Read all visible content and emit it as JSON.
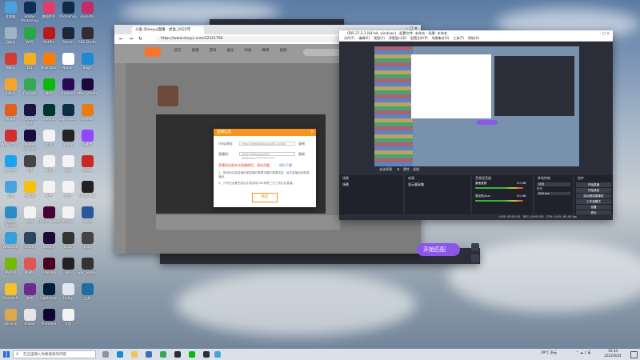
{
  "desktop": {
    "icons": [
      {
        "label": "此电脑",
        "color": "#4aa3df",
        "col": 0,
        "row": 0
      },
      {
        "label": "Adobe Photoshop",
        "color": "#0c2d56",
        "col": 1,
        "row": 0
      },
      {
        "label": "美图秀秀",
        "color": "#e23c6b",
        "col": 2,
        "row": 0
      },
      {
        "label": "Photoshop",
        "color": "#0e2a47",
        "col": 3,
        "row": 0
      },
      {
        "label": "Aseprite",
        "color": "#c42b6b",
        "col": 4,
        "row": 0
      },
      {
        "label": "回收站",
        "color": "#9fb4c7",
        "col": 0,
        "row": 1
      },
      {
        "label": "WPS",
        "color": "#27a844",
        "col": 1,
        "row": 1
      },
      {
        "label": "Netflix",
        "color": "#b71c1c",
        "col": 2,
        "row": 1
      },
      {
        "label": "Steam",
        "color": "#1b2838",
        "col": 3,
        "row": 1
      },
      {
        "label": "OBS Studio",
        "color": "#302e31",
        "col": 4,
        "row": 1
      },
      {
        "label": "网易云",
        "color": "#d33a31",
        "col": 0,
        "row": 2
      },
      {
        "label": "QQ",
        "color": "#f2b01e",
        "col": 1,
        "row": 2
      },
      {
        "label": "Illustrator",
        "color": "#ff7c00",
        "col": 2,
        "row": 2
      },
      {
        "label": "Notion",
        "color": "#ffffff",
        "col": 3,
        "row": 2
      },
      {
        "label": "Edge",
        "color": "#1e8ad2",
        "col": 4,
        "row": 2
      },
      {
        "label": "Bilibili",
        "color": "#f2a72a",
        "col": 0,
        "row": 3
      },
      {
        "label": "Chrome",
        "color": "#35a853",
        "col": 1,
        "row": 3
      },
      {
        "label": "微信",
        "color": "#09bb07",
        "col": 2,
        "row": 3
      },
      {
        "label": "Premiere",
        "color": "#2a0a58",
        "col": 3,
        "row": 3
      },
      {
        "label": "After Effects",
        "color": "#1d0a3a",
        "col": 4,
        "row": 3
      },
      {
        "label": "Origin",
        "color": "#e06020",
        "col": 0,
        "row": 4
      },
      {
        "label": "Premiere Pro",
        "color": "#1b1340",
        "col": 1,
        "row": 4
      },
      {
        "label": "Audition",
        "color": "#00362f",
        "col": 2,
        "row": 4
      },
      {
        "label": "Lightroom",
        "color": "#0f2d43",
        "col": 3,
        "row": 4
      },
      {
        "label": "Blender",
        "color": "#e87d0d",
        "col": 4,
        "row": 4
      },
      {
        "label": "WPS Office",
        "color": "#d32f2f",
        "col": 0,
        "row": 5
      },
      {
        "label": "Media Encoder",
        "color": "#1a0c3d",
        "col": 1,
        "row": 5
      },
      {
        "label": "文档",
        "color": "#f3f3f3",
        "col": 2,
        "row": 5
      },
      {
        "label": "Unity",
        "color": "#222",
        "col": 3,
        "row": 5
      },
      {
        "label": "Twitch",
        "color": "#9146ff",
        "col": 4,
        "row": 5
      },
      {
        "label": "Twitter",
        "color": "#1da1f2",
        "col": 0,
        "row": 6
      },
      {
        "label": "CD",
        "color": "#444",
        "col": 1,
        "row": 6
      },
      {
        "label": "文件",
        "color": "#f3f3f3",
        "col": 2,
        "row": 6
      },
      {
        "label": "资料",
        "color": "#f3f3f3",
        "col": 3,
        "row": 6
      },
      {
        "label": "Game",
        "color": "#c62828",
        "col": 4,
        "row": 6
      },
      {
        "label": "设置",
        "color": "#4aa3df",
        "col": 0,
        "row": 7
      },
      {
        "label": "启动器",
        "color": "#f4c20d",
        "col": 1,
        "row": 7
      },
      {
        "label": "文件",
        "color": "#f3f3f3",
        "col": 2,
        "row": 7
      },
      {
        "label": "图片",
        "color": "#f3f3f3",
        "col": 3,
        "row": 7
      },
      {
        "label": "Unity Hub",
        "color": "#222",
        "col": 4,
        "row": 7
      },
      {
        "label": "Visual Studio",
        "color": "#2c8cc6",
        "col": 0,
        "row": 8
      },
      {
        "label": "文档",
        "color": "#f3f3f3",
        "col": 1,
        "row": 8
      },
      {
        "label": "Dreamweaver",
        "color": "#470137",
        "col": 2,
        "row": 8
      },
      {
        "label": "Office",
        "color": "#f3f3f3",
        "col": 3,
        "row": 8
      },
      {
        "label": "Word",
        "color": "#2b579a",
        "col": 4,
        "row": 8
      },
      {
        "label": "WeGame",
        "color": "#34a0d8",
        "col": 0,
        "row": 9
      },
      {
        "label": "Steam",
        "color": "#2a475e",
        "col": 1,
        "row": 9
      },
      {
        "label": "InCopy",
        "color": "#1b0b32",
        "col": 2,
        "row": 9
      },
      {
        "label": "Dota",
        "color": "#333",
        "col": 3,
        "row": 9
      },
      {
        "label": "Epic",
        "color": "#444",
        "col": 4,
        "row": 9
      },
      {
        "label": "NVIDIA",
        "color": "#76b900",
        "col": 0,
        "row": 10
      },
      {
        "label": "MuMu",
        "color": "#e25454",
        "col": 1,
        "row": 10
      },
      {
        "label": "InDesign",
        "color": "#49021f",
        "col": 2,
        "row": 10
      },
      {
        "label": "Fate",
        "color": "#222",
        "col": 3,
        "row": 10
      },
      {
        "label": "Epic Games",
        "color": "#333",
        "col": 4,
        "row": 10
      },
      {
        "label": "Overwolf",
        "color": "#f3c12b",
        "col": 0,
        "row": 11
      },
      {
        "label": "游戏",
        "color": "#6c2c8c",
        "col": 1,
        "row": 11
      },
      {
        "label": "Lightroom",
        "color": "#001e36",
        "col": 2,
        "row": 11
      },
      {
        "label": "Uplay",
        "color": "#e0e7ee",
        "col": 3,
        "row": 11
      },
      {
        "label": "工具",
        "color": "#1c6ea4",
        "col": 4,
        "row": 11
      },
      {
        "label": "Genshin",
        "color": "#d9a84f",
        "col": 0,
        "row": 12
      },
      {
        "label": "Adobe",
        "color": "#e5e5e5",
        "col": 1,
        "row": 12
      },
      {
        "label": "Premiere",
        "color": "#0f0530",
        "col": 2,
        "row": 12
      },
      {
        "label": "文档",
        "color": "#f3f3f3",
        "col": 3,
        "row": 12
      }
    ]
  },
  "browser": {
    "tab_title": "斗鱼 (Douyu)直播 - 虎鱼_2022年",
    "url": "https://www.douyu.com/12321790",
    "site_nav": [
      "首页",
      "直播",
      "游戏",
      "娱乐",
      "科技",
      "赛事",
      "视频"
    ],
    "dialog": {
      "title": "直播信息",
      "fields": [
        {
          "label": "rtmp地址:",
          "value": "rtmp://sendfw.douyucdn.cn/live",
          "copy": "复制"
        },
        {
          "label": "直播码:",
          "value": "12321790rl1ee7a1?wsSecret=*************",
          "copy": "复制"
        }
      ],
      "warning": "直播码仅限本次直播使用，请勿泄露",
      "warning_link": "明白了解",
      "notes": [
        "1、推流地址和直播码是直播时需要设置的重要信息，每次直播会刷新直播码。",
        "2、只有在设置完成后才能使用OBS等第三方工具开启直播。"
      ],
      "ok_label": "确定"
    },
    "start_match_label": "开始匹配"
  },
  "obs": {
    "title": "OBS 27.2.3 (64-bit, windows) - 配置文件: 未命名 - 场景: 未命名",
    "menu": [
      "文件(F)",
      "编辑(E)",
      "视图(V)",
      "停靠窗口(D)",
      "配置文件(P)",
      "场景集合(S)",
      "工具(T)",
      "帮助(H)"
    ],
    "source_bar_label": "未选择源",
    "properties_label": "属性",
    "filters_label": "滤镜",
    "panels": {
      "scenes": {
        "header": "场景",
        "items": [
          "场景"
        ]
      },
      "sources": {
        "header": "来源",
        "items": [
          "显示器采集"
        ]
      },
      "mixer": {
        "header": "音频混音器",
        "channels": [
          {
            "name": "桌面音频",
            "db": "0.0 dB"
          },
          {
            "name": "麦克风/Aux",
            "db": "0.0 dB"
          }
        ]
      },
      "transitions": {
        "header": "转场特效",
        "type": "淡出",
        "duration_label": "时长",
        "duration": "300 ms"
      },
      "controls": {
        "header": "控件",
        "buttons": [
          "开始直播",
          "开始录制",
          "启动虚拟摄像机",
          "工作室模式",
          "设置",
          "退出"
        ]
      }
    },
    "status": {
      "live": "LIVE: 00:00:00",
      "rec": "REC: 00:00:00",
      "cpu": "CPU: 0.4%, 60.00 fps"
    }
  },
  "taskbar": {
    "search_placeholder": "在这里输入你要搜索的内容",
    "weather": "29°C 多云",
    "time": "19:34",
    "date": "2022/6/24"
  }
}
